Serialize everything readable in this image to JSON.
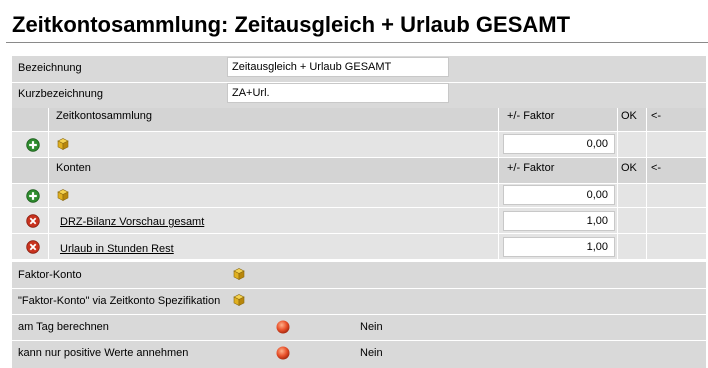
{
  "title": "Zeitkontosammlung: Zeitausgleich + Urlaub GESAMT",
  "fields": {
    "bezeichnung_label": "Bezeichnung",
    "bezeichnung_value": "Zeitausgleich + Urlaub GESAMT",
    "kurzbezeichnung_label": "Kurzbezeichnung",
    "kurzbezeichnung_value": "ZA+Url."
  },
  "zeitkontosammlung_table": {
    "header": "Zeitkontosammlung",
    "col_faktor": "+/- Faktor",
    "col_ok": "OK",
    "col_back": "<-",
    "new_row_faktor": "0,00"
  },
  "konten_table": {
    "header": "Konten",
    "col_faktor": "+/- Faktor",
    "col_ok": "OK",
    "col_back": "<-",
    "new_row_faktor": "0,00",
    "rows": [
      {
        "name": "DRZ-Bilanz Vorschau gesamt",
        "faktor": "1,00"
      },
      {
        "name": "Urlaub in Stunden Rest",
        "faktor": "1,00"
      }
    ]
  },
  "options": {
    "faktor_konto_label": "Faktor-Konto",
    "faktor_konto_spez_label": "\"Faktor-Konto\" via Zeitkonto Spezifikation",
    "am_tag_label": "am Tag berechnen",
    "am_tag_value": "Nein",
    "nur_positiv_label": "kann nur positive Werte annehmen",
    "nur_positiv_value": "Nein"
  },
  "icons": {
    "add": "add-icon",
    "delete": "delete-icon",
    "cube": "cube-icon",
    "status": "red-dot-icon"
  },
  "colors": {
    "add_green": "#2e8b2e",
    "delete_red": "#c8321e",
    "cube_yellow": "#e0b020",
    "status_red": "#e8502a"
  }
}
